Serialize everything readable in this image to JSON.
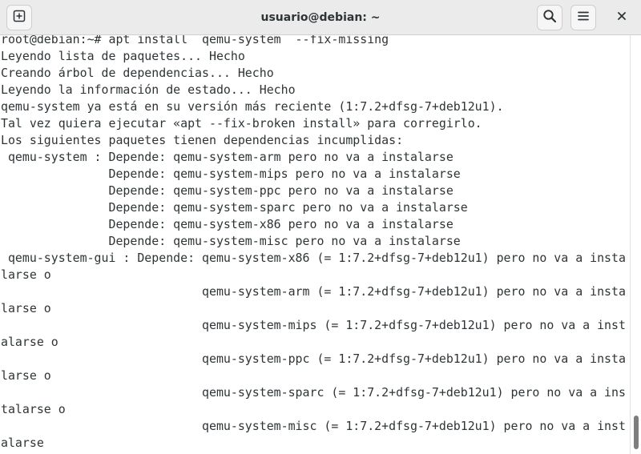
{
  "window": {
    "title": "usuario@debian: ~"
  },
  "header": {
    "new_tab_icon": "new-tab-icon",
    "search_icon": "search-icon",
    "menu_icon": "hamburger-menu-icon",
    "close_icon": "close-icon"
  },
  "terminal": {
    "lines": [
      "root@debian:~# apt install  qemu-system  --fix-missing",
      "Leyendo lista de paquetes... Hecho",
      "Creando árbol de dependencias... Hecho",
      "Leyendo la información de estado... Hecho",
      "qemu-system ya está en su versión más reciente (1:7.2+dfsg-7+deb12u1).",
      "Tal vez quiera ejecutar «apt --fix-broken install» para corregirlo.",
      "Los siguientes paquetes tienen dependencias incumplidas:",
      " qemu-system : Depende: qemu-system-arm pero no va a instalarse",
      "               Depende: qemu-system-mips pero no va a instalarse",
      "               Depende: qemu-system-ppc pero no va a instalarse",
      "               Depende: qemu-system-sparc pero no va a instalarse",
      "               Depende: qemu-system-x86 pero no va a instalarse",
      "               Depende: qemu-system-misc pero no va a instalarse",
      " qemu-system-gui : Depende: qemu-system-x86 (= 1:7.2+dfsg-7+deb12u1) pero no va a insta",
      "larse o",
      "                            qemu-system-arm (= 1:7.2+dfsg-7+deb12u1) pero no va a insta",
      "larse o",
      "                            qemu-system-mips (= 1:7.2+dfsg-7+deb12u1) pero no va a inst",
      "alarse o",
      "                            qemu-system-ppc (= 1:7.2+dfsg-7+deb12u1) pero no va a insta",
      "larse o",
      "                            qemu-system-sparc (= 1:7.2+dfsg-7+deb12u1) pero no va a ins",
      "talarse o",
      "                            qemu-system-misc (= 1:7.2+dfsg-7+deb12u1) pero no va a inst",
      "alarse"
    ]
  },
  "colors": {
    "terminal_text": "#2e3436",
    "terminal_background": "#ffffff",
    "headerbar_background": "#ebebeb"
  }
}
